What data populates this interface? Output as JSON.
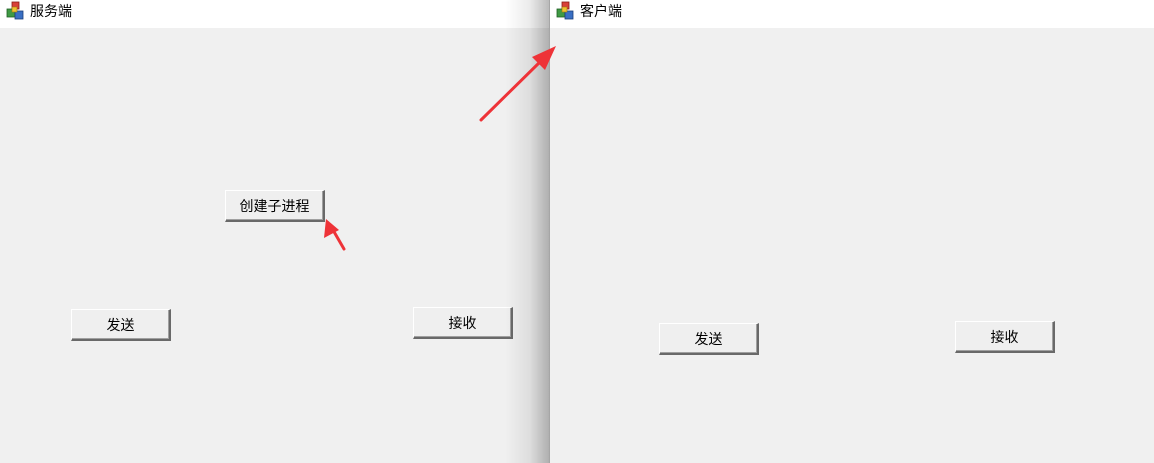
{
  "server_window": {
    "title": "服务端",
    "icon": "app-icon",
    "buttons": {
      "create_child_process": "创建子进程",
      "send": "发送",
      "receive": "接收"
    }
  },
  "client_window": {
    "title": "客户端",
    "icon": "app-icon",
    "buttons": {
      "send": "发送",
      "receive": "接收"
    }
  },
  "annotation": {
    "arrow_color": "#ee3338"
  }
}
